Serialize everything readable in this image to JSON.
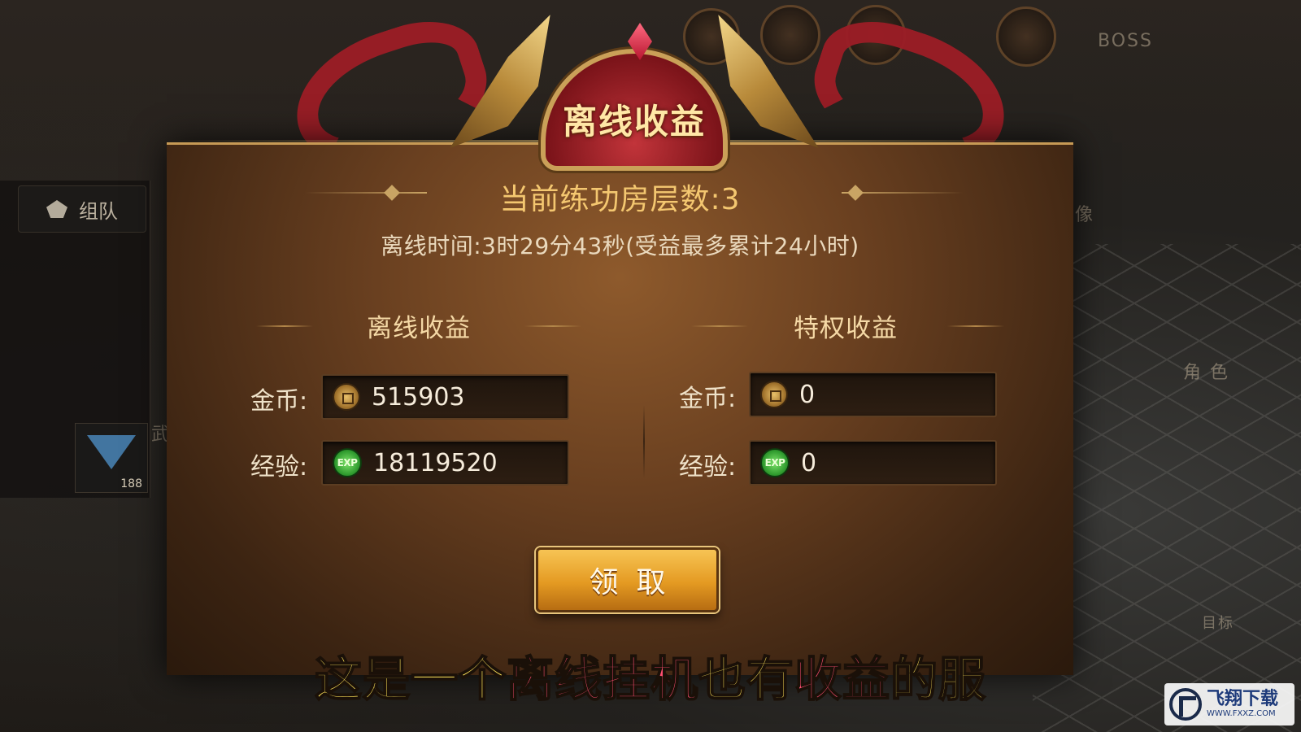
{
  "background": {
    "team_label": "组队",
    "gem_count": "188",
    "statue_label": "城主雕像",
    "role_label": "角 色",
    "target_label": "目标",
    "martial_label": "武道巅峰",
    "boss_label": "BOSS"
  },
  "dialog": {
    "title": "离线收益",
    "floor_text": "当前练功房层数:3",
    "offline_time_text": "离线时间:3时29分43秒(受益最多累计24小时)",
    "offline_column": {
      "heading": "离线收益",
      "gold_label": "金币:",
      "gold_value": "515903",
      "exp_label": "经验:",
      "exp_value": "18119520"
    },
    "privilege_column": {
      "heading": "特权收益",
      "gold_label": "金币:",
      "gold_value": "0",
      "exp_label": "经验:",
      "exp_value": "0"
    },
    "claim_button": "领取"
  },
  "caption": {
    "part1": "这是一个",
    "part2": "离线挂机",
    "part3": "也有",
    "part4": "收益",
    "part5": "的服"
  },
  "watermark": {
    "brand": "飞翔下载",
    "url": "WWW.FXXZ.COM"
  },
  "colors": {
    "caption_yellow": "#ffe45a",
    "caption_red": "#ff4f72",
    "button_gold": "#e49a22",
    "title_gold": "#f4c770"
  },
  "icons": [
    "coin-icon",
    "exp-icon",
    "team-icon",
    "gem-icon",
    "crest-gem-icon",
    "fxxz-logo-icon"
  ]
}
